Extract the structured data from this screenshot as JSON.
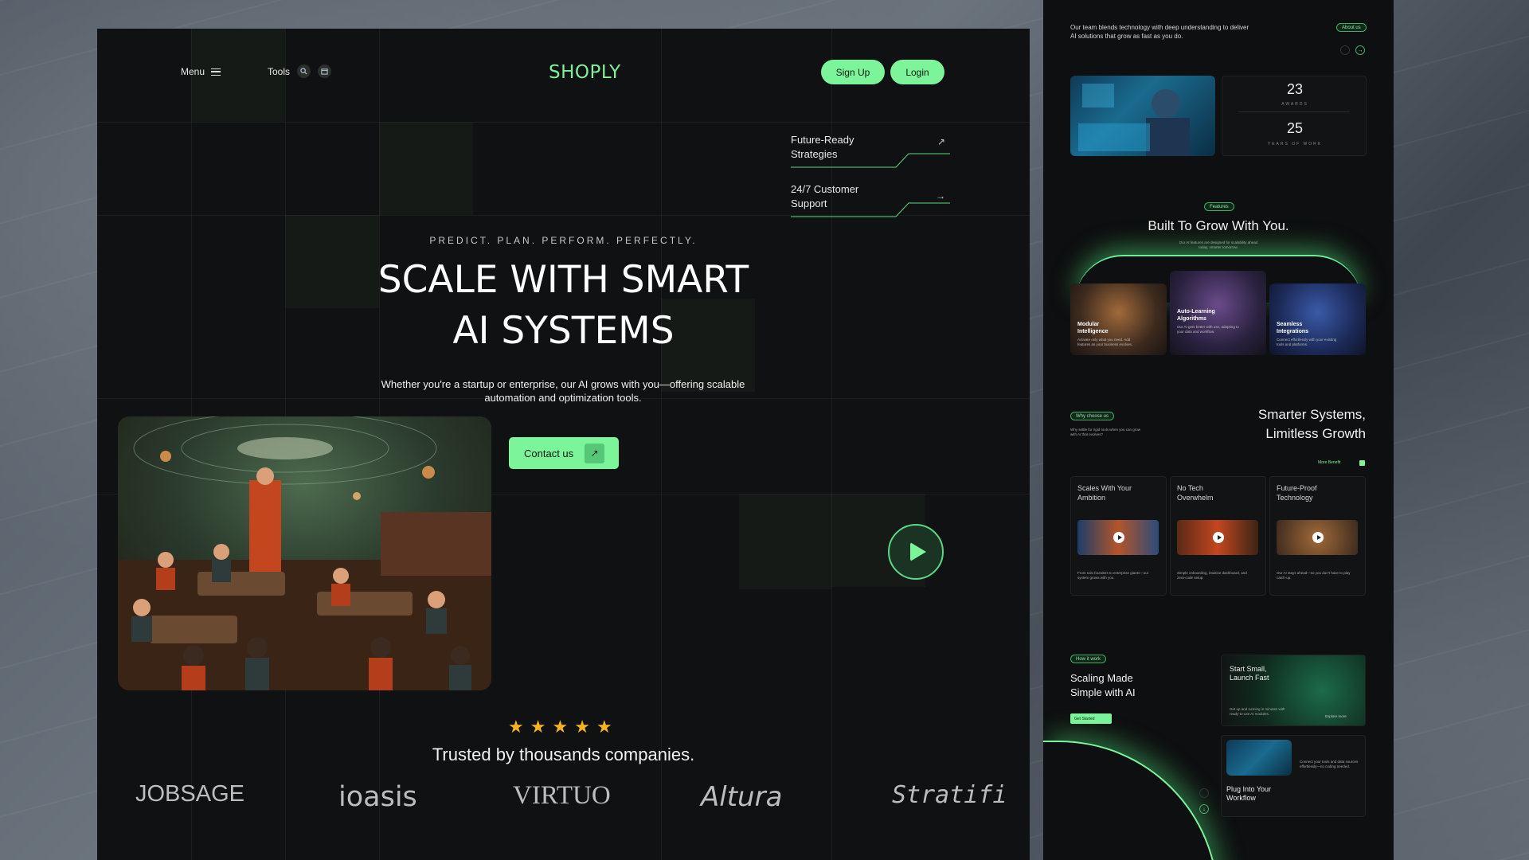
{
  "nav": {
    "menu_label": "Menu",
    "tools_label": "Tools",
    "logo": "SHOPLY",
    "signup_label": "Sign Up",
    "login_label": "Login"
  },
  "feature_links": [
    {
      "line1": "Future-Ready",
      "line2": "Strategies",
      "icon": "arrow-up-right-icon"
    },
    {
      "line1": "24/7 Customer",
      "line2": "Support",
      "icon": "arrow-right-icon"
    }
  ],
  "hero": {
    "tagline": "PREDICT. PLAN. PERFORM. PERFECTLY.",
    "title_line1": "SCALE WITH SMART",
    "title_line2": "AI SYSTEMS",
    "description": "Whether you're a startup or enterprise, our AI grows with you—offering scalable automation and optimization tools.",
    "contact_label": "Contact us"
  },
  "trust": {
    "rating": 5,
    "text": "Trusted by thousands companies."
  },
  "brands": [
    "JOBSAGE",
    "ioasis",
    "VIRTUO",
    "Altura",
    "Stratifi"
  ],
  "side": {
    "about_text": "Our team blends technology with deep understanding to deliver AI solutions that grow as fast as you do.",
    "about_tag": "About us",
    "stats": [
      {
        "value": "23",
        "label": "AWARDS"
      },
      {
        "value": "25",
        "label": "YEARS OF WORK"
      }
    ],
    "features_tag": "Features",
    "features_title": "Built To Grow With You.",
    "features_sub": "Our AI features are designed for scalability ahead today, smarter tomorrow.",
    "feature_cards": [
      {
        "title1": "Modular",
        "title2": "Intelligence",
        "sub": "Activate only what you need. Add features as your business evolves."
      },
      {
        "title1": "Auto-Learning",
        "title2": "Algorithms",
        "sub": "Our AI gets better with use, adapting to your data and workflow."
      },
      {
        "title1": "Seamless",
        "title2": "Integrations",
        "sub": "Connect effortlessly with your existing tools and platforms."
      }
    ],
    "why_tag": "Why choose us",
    "why_sub": "Why settle for rigid tools when you can grow with AI that evolves?",
    "why_title1": "Smarter Systems,",
    "why_title2": "Limitless Growth",
    "more_benefit": "More Benefit",
    "why_cards": [
      {
        "title1": "Scales With Your",
        "title2": "Ambition",
        "sub": "From solo founders to enterprise giants—our system grows with you."
      },
      {
        "title1": "No Tech",
        "title2": "Overwhelm",
        "sub": "Simple onboarding, intuitive dashboard, and zero-code setup."
      },
      {
        "title1": "Future-Proof",
        "title2": "Technology",
        "sub": "Our AI stays ahead—so you don't have to play catch-up."
      }
    ],
    "how_tag": "How it work",
    "how_title1": "Scaling Made",
    "how_title2": "Simple with AI",
    "get_started": "Get Started",
    "start_title1": "Start Small,",
    "start_title2": "Launch Fast",
    "start_sub": "Get up and running in minutes with ready-to-use AI modules.",
    "explore": "Explore more",
    "plug_title1": "Plug Into Your",
    "plug_title2": "Workflow",
    "plug_sub": "Connect your tools and data sources effortlessly—no coding needed."
  }
}
